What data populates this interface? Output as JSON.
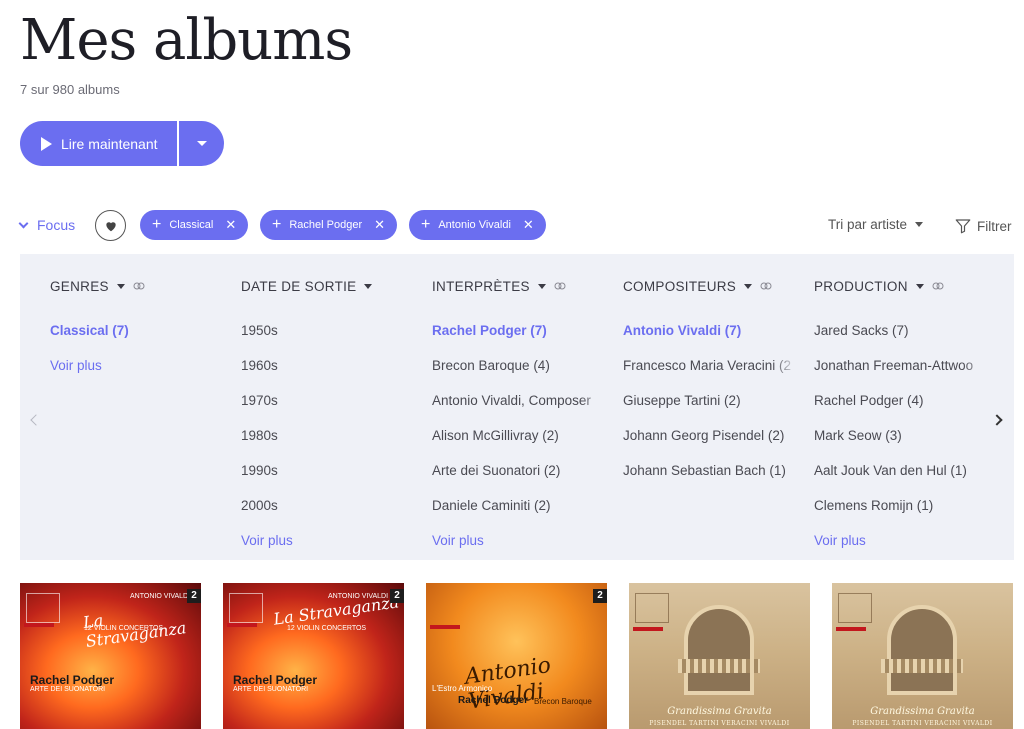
{
  "header": {
    "title": "Mes albums",
    "count": "7 sur 980 albums"
  },
  "play": {
    "label": "Lire maintenant"
  },
  "focus": {
    "label": "Focus"
  },
  "chips": [
    {
      "label": "Classical"
    },
    {
      "label": "Rachel Podger"
    },
    {
      "label": "Antonio Vivaldi"
    }
  ],
  "sort": {
    "label": "Tri par artiste"
  },
  "filter": {
    "label": "Filtrer"
  },
  "columns": [
    {
      "title": "GENRES",
      "items": [
        "Classical (7)"
      ],
      "more": "Voir plus"
    },
    {
      "title": "DATE DE SORTIE",
      "items": [
        "1950s",
        "1960s",
        "1970s",
        "1980s",
        "1990s",
        "2000s"
      ],
      "more": "Voir plus"
    },
    {
      "title": "INTERPRÈTES",
      "items": [
        "Rachel Podger (7)",
        "Brecon Baroque (4)",
        "Antonio Vivaldi, Composer",
        "Alison McGillivray (2)",
        "Arte dei Suonatori (2)",
        "Daniele Caminiti (2)"
      ],
      "more": "Voir plus"
    },
    {
      "title": "COMPOSITEURS",
      "items": [
        "Antonio Vivaldi (7)",
        "Francesco Maria Veracini (2",
        "Giuseppe Tartini (2)",
        "Johann Georg Pisendel (2)",
        "Johann Sebastian Bach (1)"
      ]
    },
    {
      "title": "PRODUCTION",
      "items": [
        "Jared Sacks (7)",
        "Jonathan Freeman-Attwoo",
        "Rachel Podger (4)",
        "Mark Seow (3)",
        "Aalt Jouk Van den Hul (1)",
        "Clemens Romijn (1)"
      ],
      "more": "Voir plus"
    }
  ],
  "albums": [
    {
      "badge": "2",
      "title": "La Stravaganza",
      "composer": "ANTONIO VIVALDI",
      "sub": "12 VIOLIN CONCERTOS",
      "artist": "Rachel Podger",
      "ensemble": "ARTE DEI SUONATORI"
    },
    {
      "badge": "2",
      "title": "La Stravaganza",
      "composer": "ANTONIO VIVALDI",
      "sub": "12 VIOLIN CONCERTOS",
      "artist": "Rachel Podger",
      "ensemble": "ARTE DEI SUONATORI"
    },
    {
      "badge": "2",
      "title": "Antonio Vivaldi",
      "sub": "L'Estro Armonico",
      "artist": "Rachel Podger",
      "ensemble": "Brecon Baroque"
    },
    {
      "title": "Grandissima Gravita",
      "composers": "PISENDEL TARTINI VERACINI VIVALDI"
    },
    {
      "title": "Grandissima Gravita",
      "composers": "PISENDEL TARTINI VERACINI VIVALDI"
    }
  ],
  "colors": {
    "accent": "#6b6ef0",
    "panel": "#eff1f7"
  }
}
